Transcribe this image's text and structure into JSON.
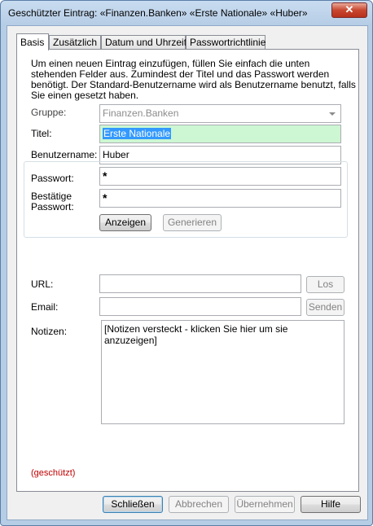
{
  "window": {
    "title": "Geschützter Eintrag:  «Finanzen.Banken» «Erste Nationale» «Huber»",
    "close_glyph": "✕"
  },
  "tabs": [
    {
      "label": "Basis",
      "active": true
    },
    {
      "label": "Zusätzlich",
      "active": false
    },
    {
      "label": "Datum und Uhrzeit",
      "active": false
    },
    {
      "label": "Passwortrichtlinie",
      "active": false
    }
  ],
  "intro": "Um einen neuen Eintrag einzufügen, füllen Sie einfach die unten stehenden Felder aus. Zumindest der Titel und das Passwort werden benötigt. Der Standard-Benutzername wird als Benutzername benutzt, falls Sie einen gesetzt haben.",
  "form": {
    "group_label": "Gruppe:",
    "group_value": "Finanzen.Banken",
    "title_label": "Titel:",
    "title_value": "Erste Nationale",
    "username_label": "Benutzername:",
    "username_value": "Huber",
    "password_label": "Passwort:",
    "password_value": "*",
    "confirm_label_1": "Bestätige",
    "confirm_label_2": "Passwort:",
    "confirm_value": "*",
    "show_button": "Anzeigen",
    "generate_button": "Generieren",
    "url_label": "URL:",
    "url_value": "",
    "go_button": "Los",
    "email_label": "Email:",
    "email_value": "",
    "send_button": "Senden",
    "notes_label": "Notizen:",
    "notes_value": "[Notizen versteckt - klicken Sie hier um sie anzuzeigen]",
    "protected_text": "(geschützt)"
  },
  "buttons": {
    "close": "Schließen",
    "cancel": "Abbrechen",
    "apply": "Übernehmen",
    "help": "Hilfe"
  }
}
